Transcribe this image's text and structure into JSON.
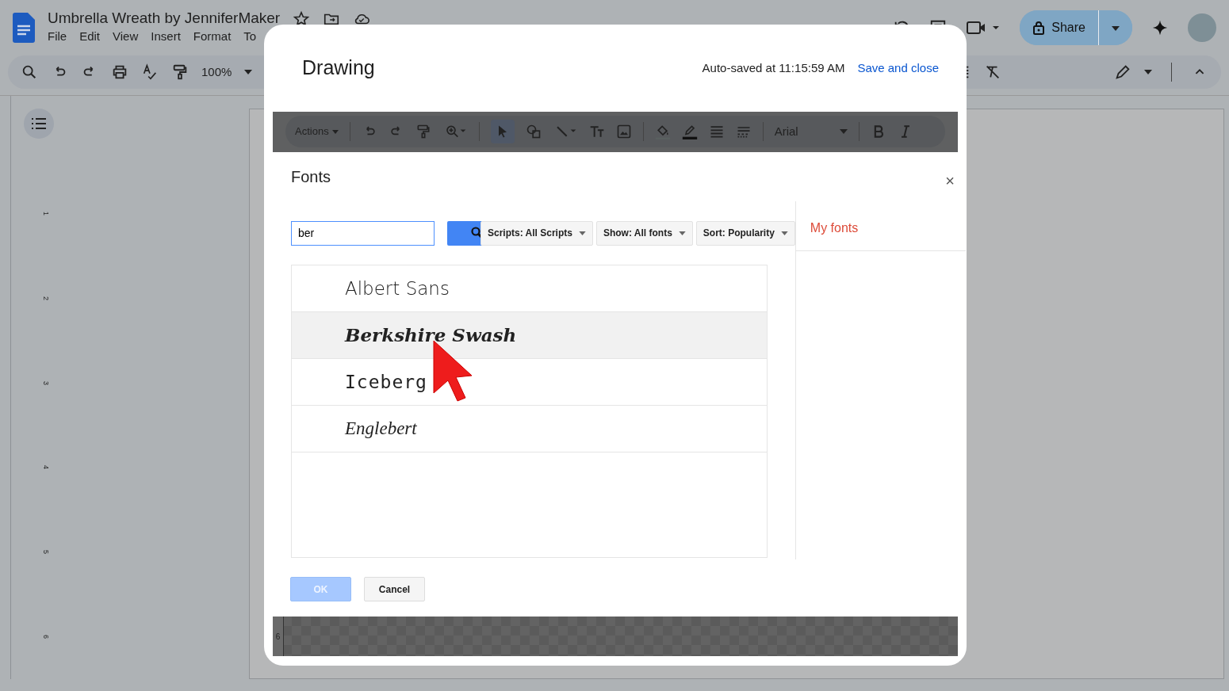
{
  "docs": {
    "title": "Umbrella Wreath by JenniferMaker",
    "menu": [
      "File",
      "Edit",
      "View",
      "Insert",
      "Format",
      "To"
    ],
    "zoom": "100%",
    "share": "Share",
    "ruler_numbers": [
      "1",
      "2",
      "3",
      "4",
      "5",
      "6"
    ]
  },
  "drawing": {
    "title": "Drawing",
    "autosave": "Auto-saved at 11:15:59 AM",
    "save_close": "Save and close",
    "toolbar": {
      "actions": "Actions",
      "font": "Arial"
    },
    "canvas_ruler": "6"
  },
  "fonts_dialog": {
    "title": "Fonts",
    "close": "×",
    "search": {
      "value": "ber"
    },
    "filters": [
      "Scripts: All Scripts",
      "Show: All fonts",
      "Sort: Popularity"
    ],
    "fonts": [
      {
        "name": "Albert Sans",
        "kind": "sans",
        "selected": false
      },
      {
        "name": "Berkshire Swash",
        "kind": "swash",
        "selected": true
      },
      {
        "name": "Iceberg",
        "kind": "square",
        "selected": false
      },
      {
        "name": "Englebert",
        "kind": "script",
        "selected": false
      }
    ],
    "my_fonts": "My fonts",
    "buttons": [
      {
        "label": "OK",
        "kind": "primary",
        "disabled": true
      },
      {
        "label": "Cancel",
        "kind": "secondary",
        "disabled": false
      }
    ]
  }
}
